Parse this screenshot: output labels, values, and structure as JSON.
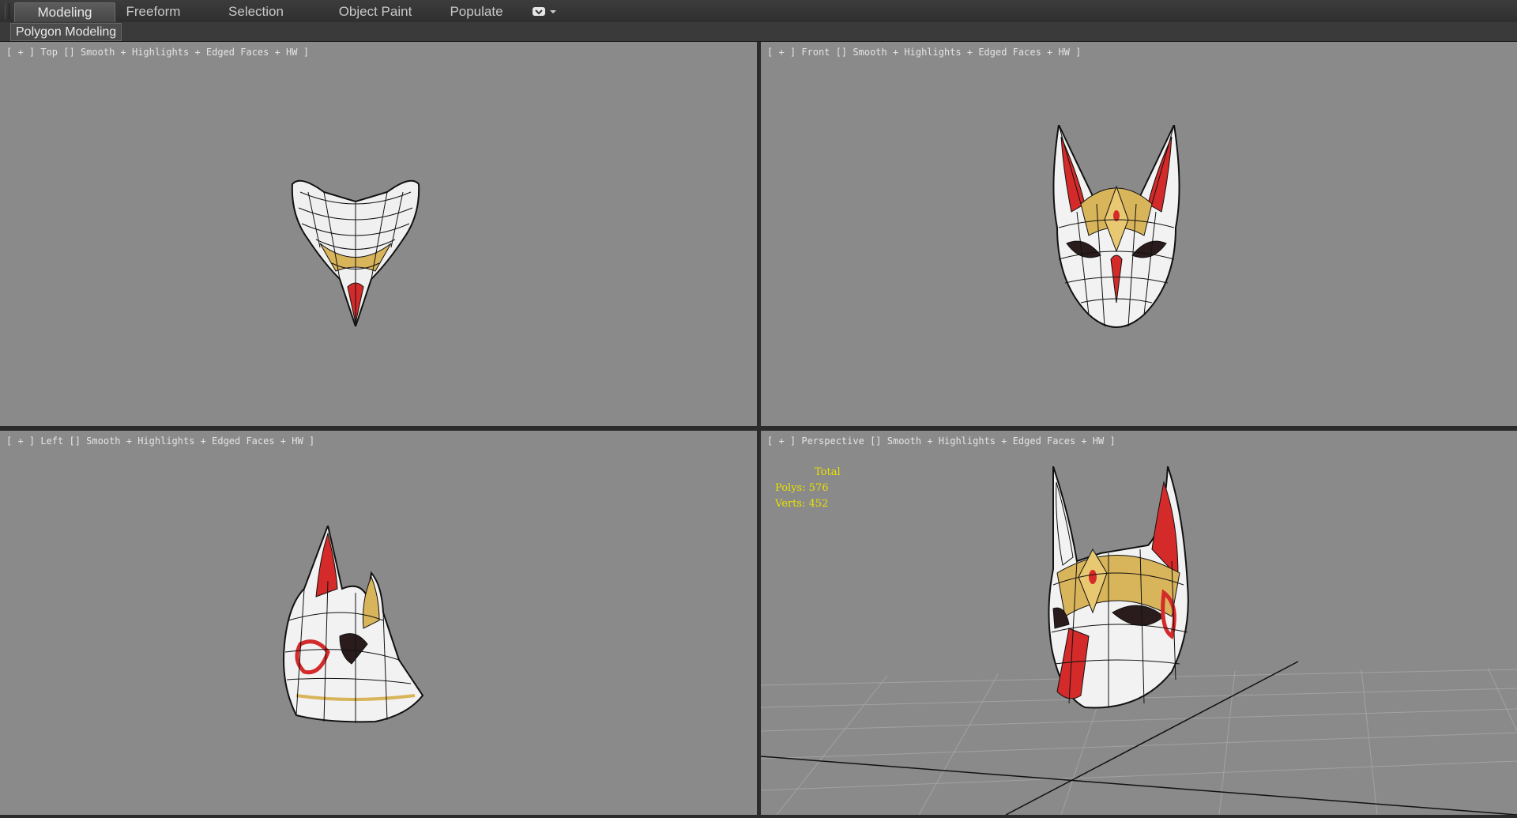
{
  "ribbon": {
    "tabs": [
      {
        "label": "Modeling",
        "active": true
      },
      {
        "label": "Freeform",
        "active": false
      },
      {
        "label": "Selection",
        "active": false
      },
      {
        "label": "Object Paint",
        "active": false
      },
      {
        "label": "Populate",
        "active": false
      }
    ],
    "panel_label": "Polygon Modeling"
  },
  "viewports": {
    "top": {
      "plus": "[ + ]",
      "view": "Top",
      "shading": "Smooth + Highlights + Edged Faces + HW",
      "close": "]"
    },
    "front": {
      "plus": "[ + ]",
      "view": "Front",
      "shading": "Smooth + Highlights + Edged Faces + HW",
      "close": "]"
    },
    "left": {
      "plus": "[ + ]",
      "view": "Left",
      "shading": "Smooth + Highlights + Edged Faces + HW",
      "close": "]"
    },
    "perspective": {
      "plus": "[ + ]",
      "view": "Perspective",
      "shading": "Smooth + Highlights + Edged Faces + HW",
      "close": "]"
    }
  },
  "stats": {
    "total": "Total",
    "polys": "Polys: 576",
    "verts": "Verts: 452"
  },
  "colors": {
    "viewport_bg": "#8a8a8a",
    "stats_text": "#e8e000",
    "mask_red": "#d42a2a",
    "mask_gold": "#d8b45a",
    "mask_white": "#f2f2f2"
  }
}
